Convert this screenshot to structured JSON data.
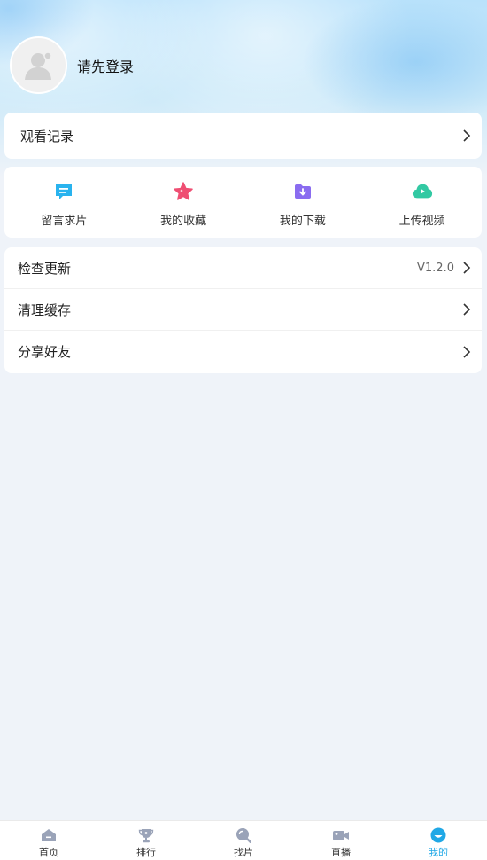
{
  "profile": {
    "login_text": "请先登录"
  },
  "history": {
    "label": "观看记录"
  },
  "quick_actions": [
    {
      "label": "留言求片",
      "icon": "message-icon",
      "color": "#29b3ee"
    },
    {
      "label": "我的收藏",
      "icon": "star-icon",
      "color": "#ef4f73"
    },
    {
      "label": "我的下载",
      "icon": "download-folder-icon",
      "color": "#8a6cf0"
    },
    {
      "label": "上传视频",
      "icon": "cloud-upload-icon",
      "color": "#32c9a3"
    }
  ],
  "settings": [
    {
      "label": "检查更新",
      "value": "V1.2.0"
    },
    {
      "label": "清理缓存"
    },
    {
      "label": "分享好友"
    }
  ],
  "tabs": [
    {
      "label": "首页",
      "icon": "home-icon"
    },
    {
      "label": "排行",
      "icon": "trophy-icon"
    },
    {
      "label": "找片",
      "icon": "search-icon"
    },
    {
      "label": "直播",
      "icon": "video-camera-icon"
    },
    {
      "label": "我的",
      "icon": "profile-icon",
      "active": true
    }
  ],
  "colors": {
    "accent": "#20a8e6",
    "tab_inactive_icon": "#9aa3b8",
    "background": "#eff3f9"
  }
}
